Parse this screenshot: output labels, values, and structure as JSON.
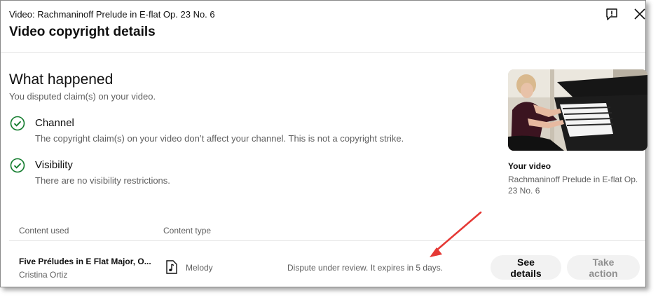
{
  "header": {
    "video_line": "Video: Rachmaninoff Prelude in E-flat Op. 23 No. 6",
    "title": "Video copyright details",
    "feedback_icon": "report-flag-icon",
    "close_icon": "close-icon"
  },
  "what_happened": {
    "title": "What happened",
    "subtitle": "You disputed claim(s) on your video.",
    "items": [
      {
        "title": "Channel",
        "text": "The copyright claim(s) on your video don’t affect your channel. This is not a copyright strike.",
        "icon": "check-circle-icon"
      },
      {
        "title": "Visibility",
        "text": "There are no visibility restrictions.",
        "icon": "check-circle-icon"
      }
    ]
  },
  "your_video": {
    "label": "Your video",
    "title": "Rachmaninoff Prelude in E-flat Op. 23 No. 6"
  },
  "table": {
    "headers": [
      "Content used",
      "Content type"
    ],
    "rows": [
      {
        "content": "Five Préludes in E Flat Major, O...",
        "artist": "Cristina Ortiz",
        "type_icon": "music-note-icon",
        "type": "Melody",
        "status": "Dispute under review. It expires in 5 days.",
        "actions": [
          "See details",
          "Take action"
        ]
      }
    ]
  },
  "colors": {
    "check_green": "#0f7a2a",
    "annotation_arrow": "#e53935",
    "button_bg": "#f2f2f2"
  }
}
